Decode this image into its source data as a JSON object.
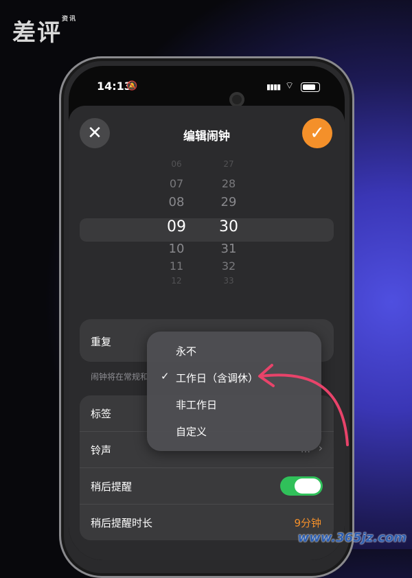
{
  "watermark": {
    "text": "差评",
    "small": "资讯"
  },
  "footer": {
    "url": "www.365jz.com"
  },
  "status": {
    "time": "14:13",
    "bell": "🔕",
    "signal": "▮▮▮▮",
    "wifi": "⌔"
  },
  "header": {
    "close": "✕",
    "title": "编辑闹钟",
    "confirm": "✓"
  },
  "picker": {
    "hours": [
      "06",
      "07",
      "08",
      "09",
      "10",
      "11",
      "12"
    ],
    "minutes": [
      "27",
      "28",
      "29",
      "30",
      "31",
      "32",
      "33"
    ],
    "selected_hour": "09",
    "selected_minute": "30"
  },
  "repeat": {
    "label": "重复",
    "hint": "闹钟将在常规和"
  },
  "settings": {
    "label_row": "标签",
    "sound_row": "铃声",
    "sound_value": "...",
    "snooze_row": "稍后提醒",
    "snooze_on": true,
    "snooze_duration_row": "稍后提醒时长",
    "snooze_duration_value": "9分钟"
  },
  "menu": {
    "items": [
      {
        "label": "永不",
        "checked": false
      },
      {
        "label": "工作日（含调休）",
        "checked": true
      },
      {
        "label": "非工作日",
        "checked": false
      },
      {
        "label": "自定义",
        "checked": false
      }
    ],
    "check_mark": "✓"
  },
  "colors": {
    "accent": "#f4902a",
    "toggle_on": "#30c05a",
    "arrow": "#e8436a"
  }
}
